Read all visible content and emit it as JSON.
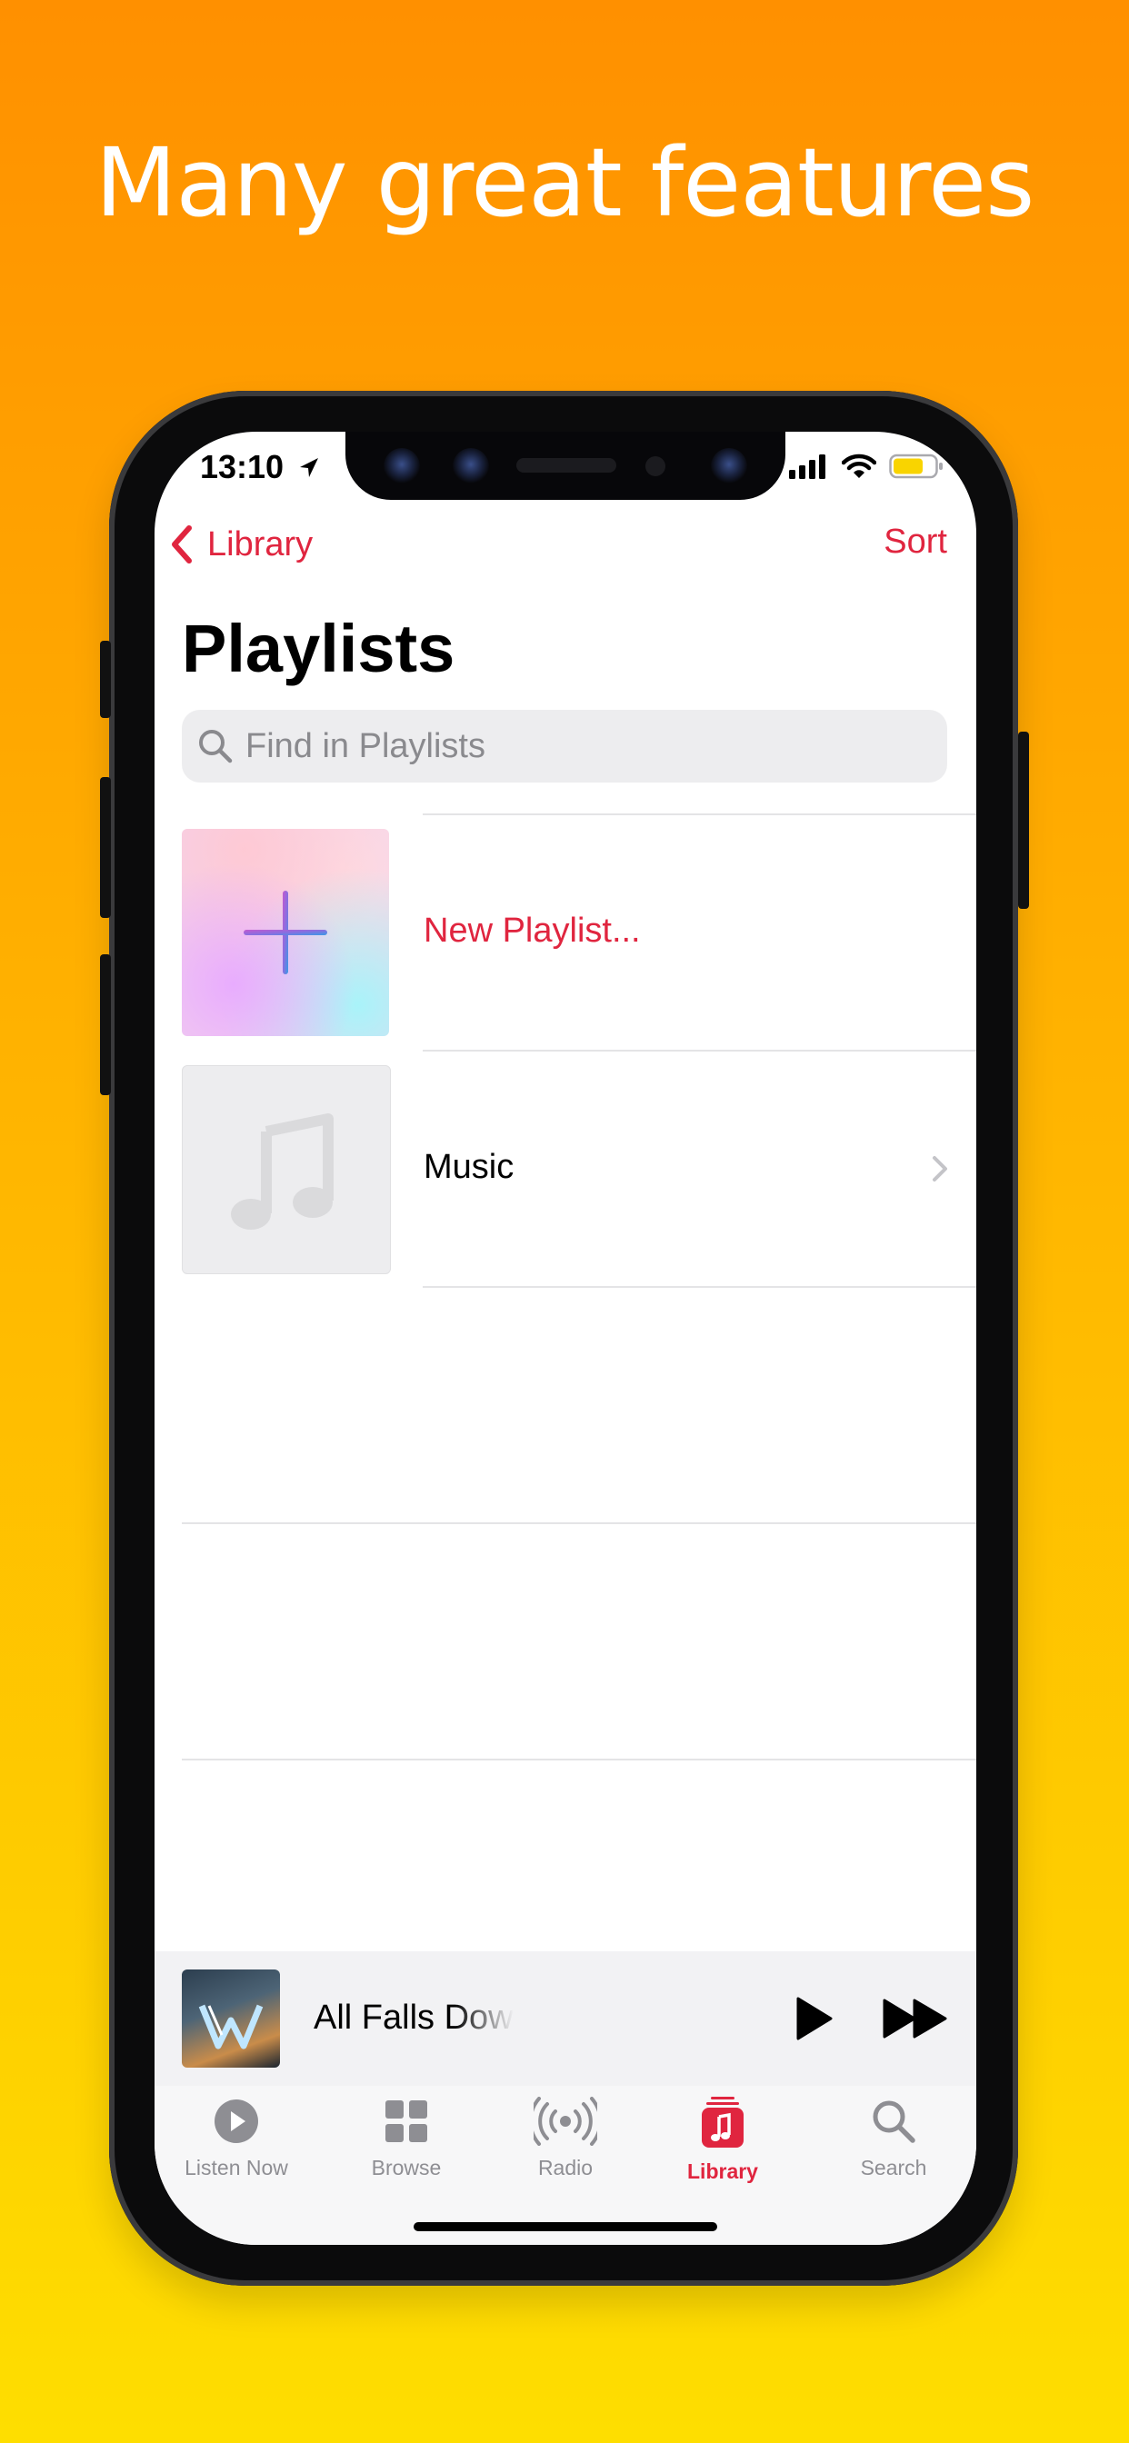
{
  "headline": "Many great features",
  "status_bar": {
    "time": "13:10"
  },
  "nav": {
    "back_label": "Library",
    "sort_label": "Sort"
  },
  "page": {
    "title": "Playlists"
  },
  "search": {
    "placeholder": "Find in Playlists"
  },
  "playlists": [
    {
      "label": "New Playlist...",
      "kind": "new"
    },
    {
      "label": "Music",
      "kind": "playlist"
    }
  ],
  "now_playing": {
    "title": "All Falls Dow"
  },
  "tabs": [
    {
      "label": "Listen Now",
      "icon": "play-circle-icon",
      "active": false
    },
    {
      "label": "Browse",
      "icon": "grid-icon",
      "active": false
    },
    {
      "label": "Radio",
      "icon": "radio-waves-icon",
      "active": false
    },
    {
      "label": "Library",
      "icon": "library-note-icon",
      "active": true
    },
    {
      "label": "Search",
      "icon": "search-icon",
      "active": false
    }
  ],
  "colors": {
    "accent": "#e0253f",
    "background_top": "#ff9000",
    "background_bottom": "#fede00"
  }
}
